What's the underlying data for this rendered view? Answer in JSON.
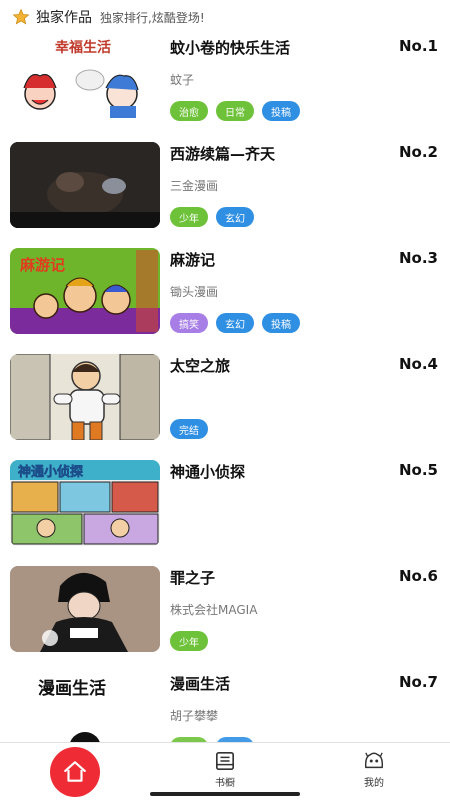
{
  "header": {
    "title": "独家作品",
    "subtitle": "独家排行,炫酷登场!",
    "icon": "star-icon"
  },
  "colors": {
    "accent": "#ef2b35",
    "tag_green": "#6ec23a",
    "tag_blue": "#2f8fe3",
    "tag_purple": "#a77ee6",
    "star": "#f2b233"
  },
  "items": [
    {
      "name": "蚊小卷的快乐生活",
      "rank": "No.1",
      "author": "蚊子",
      "cover_text": "幸福生活",
      "tags": [
        {
          "label": "治愈",
          "color": "green"
        },
        {
          "label": "日常",
          "color": "green"
        },
        {
          "label": "投稿",
          "color": "blue"
        }
      ]
    },
    {
      "name": "西游续篇—齐天",
      "rank": "No.2",
      "author": "三金漫画",
      "tags": [
        {
          "label": "少年",
          "color": "green"
        },
        {
          "label": "玄幻",
          "color": "blue"
        }
      ]
    },
    {
      "name": "麻游记",
      "rank": "No.3",
      "author": "锄头漫画",
      "cover_text": "麻游记",
      "tags": [
        {
          "label": "搞笑",
          "color": "purple"
        },
        {
          "label": "玄幻",
          "color": "blue"
        },
        {
          "label": "投稿",
          "color": "blue"
        }
      ]
    },
    {
      "name": "太空之旅",
      "rank": "No.4",
      "author": "",
      "tags": [
        {
          "label": "完结",
          "color": "blue"
        }
      ]
    },
    {
      "name": "神通小侦探",
      "rank": "No.5",
      "author": "",
      "cover_text": "神通小侦探",
      "tags": []
    },
    {
      "name": "罪之子",
      "rank": "No.6",
      "author": "株式会社MAGIA",
      "tags": [
        {
          "label": "少年",
          "color": "green"
        }
      ]
    },
    {
      "name": "漫画生活",
      "rank": "No.7",
      "author": "胡子攀攀",
      "cover_text": "漫画生活",
      "tags": []
    }
  ],
  "tabbar": {
    "home_icon": "home-icon",
    "bookshelf_label": "书橱",
    "mine_label": "我的"
  }
}
